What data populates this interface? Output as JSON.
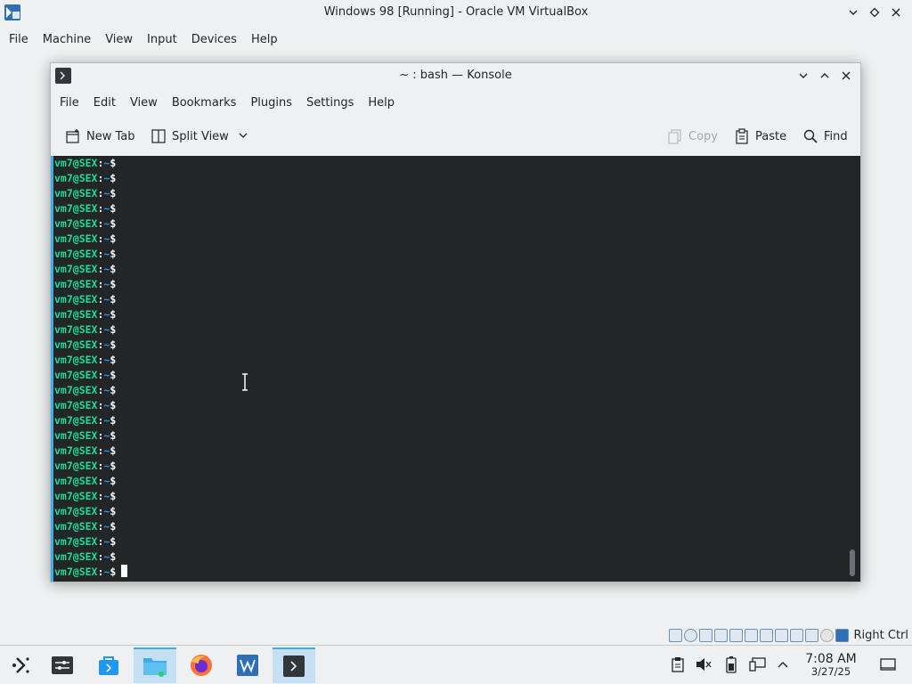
{
  "host_window": {
    "title": "Windows 98 [Running] - Oracle VM VirtualBox",
    "menu": [
      "File",
      "Machine",
      "View",
      "Input",
      "Devices",
      "Help"
    ]
  },
  "konsole": {
    "title": "~ : bash — Konsole",
    "menu": [
      "File",
      "Edit",
      "View",
      "Bookmarks",
      "Plugins",
      "Settings",
      "Help"
    ],
    "toolbar": {
      "new_tab": "New Tab",
      "split_view": "Split View",
      "copy": "Copy",
      "paste": "Paste",
      "find": "Find"
    },
    "terminal": {
      "prompt_user": "vm7@SEX",
      "prompt_sep": ":",
      "prompt_path": "~",
      "prompt_symbol": "$",
      "line_count": 28
    }
  },
  "status_bar": {
    "host_key_label": "Right Ctrl",
    "icons": [
      "hard-disk-icon",
      "optical-disk-icon",
      "floppy-icon",
      "audio-icon",
      "network-icon",
      "usb-icon",
      "shared-folders-icon",
      "display-icon",
      "video-capture-icon",
      "recording-icon",
      "mouse-integration-icon",
      "keyboard-capture-icon"
    ]
  },
  "taskbar": {
    "apps": [
      "application-launcher",
      "desktop-pager",
      "discover",
      "file-manager",
      "firefox",
      "virtualbox",
      "konsole"
    ],
    "clock": {
      "time": "7:08 AM",
      "date": "3/27/25"
    }
  },
  "colors": {
    "prompt_user": "#1cdc9a",
    "prompt_path": "#1d99f3",
    "terminal_bg": "#232627",
    "accent": "#3daee9"
  }
}
